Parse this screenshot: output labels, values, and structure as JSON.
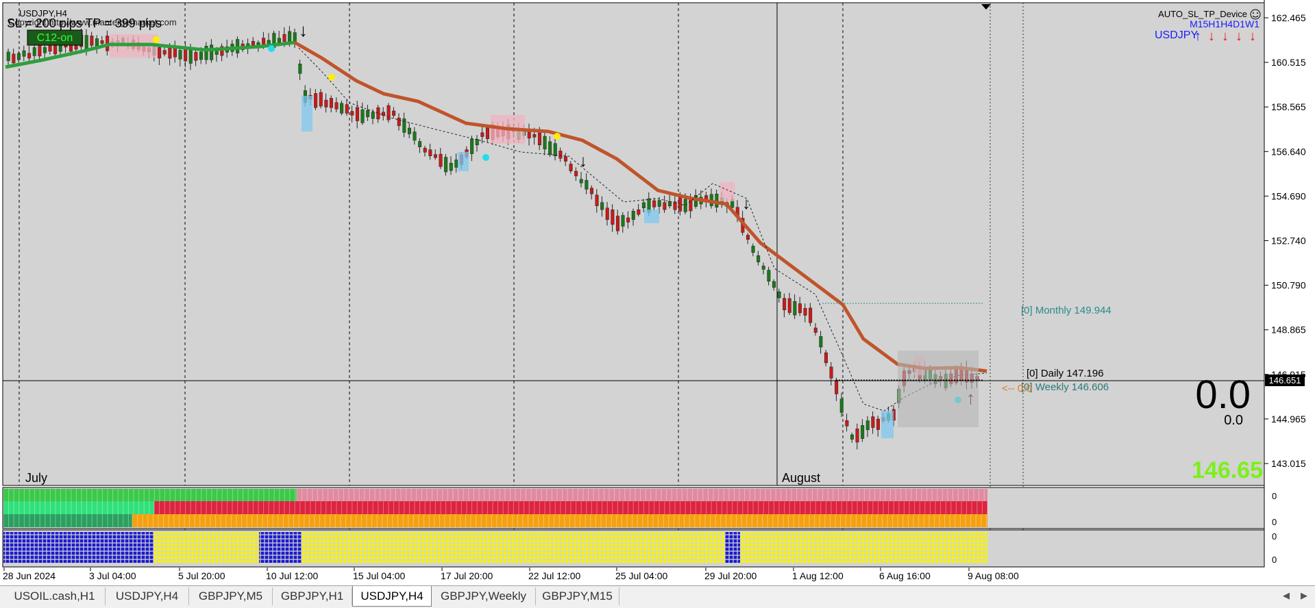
{
  "chart": {
    "symbol_title": "USDJPY,H4",
    "header_overlay": "SL = 200 pips   TP = 399 pips",
    "copyright": "Copyright http://www.mantergemarket.com",
    "indicator_button": "C12-on",
    "expert_name": "AUTO_SL_TP_Device",
    "expert_face_icon": "smiley-icon",
    "mtf_symbol": "USDJPY",
    "mtf_timeframes": "M15H1H4D1W1",
    "mtf_arrows": [
      "up",
      "down",
      "down",
      "down",
      "down"
    ],
    "month_labels": [
      "July",
      "August"
    ],
    "level_monthly": "[0] Monthly 149.944",
    "level_daily": "[0] Daily 147.196",
    "level_weekly": "[0] Weekly 146.606",
    "level_arrow_text": "<-- 0.0",
    "big_value": "0.0",
    "small_value": "0.0",
    "price_display": "146.65",
    "current_price_label": "146.651",
    "colors": {
      "ma": "#c0542b",
      "ma_early": "#2e9e3e",
      "bull": "#1a7a1a",
      "bear": "#cc1a1a",
      "price_green": "#7bf01a"
    }
  },
  "price_axis": [
    "162.465",
    "160.515",
    "158.565",
    "156.640",
    "154.690",
    "152.740",
    "150.790",
    "148.865",
    "146.915",
    "144.965",
    "143.015"
  ],
  "time_axis": [
    "28 Jun 2024",
    "3 Jul 04:00",
    "5 Jul 20:00",
    "10 Jul 12:00",
    "15 Jul 04:00",
    "17 Jul 20:00",
    "22 Jul 12:00",
    "25 Jul 04:00",
    "29 Jul 20:00",
    "1 Aug 12:00",
    "6 Aug 16:00",
    "9 Aug 08:00"
  ],
  "indicator1_scale": [
    "0",
    "0"
  ],
  "indicator2_scale": [
    "0",
    "0"
  ],
  "tabs": [
    "USOIL.cash,H1",
    "USDJPY,H4",
    "GBPJPY,M5",
    "GBPJPY,H1",
    "USDJPY,H4",
    "GBPJPY,Weekly",
    "GBPJPY,M15"
  ],
  "active_tab": 4,
  "chart_data": {
    "type": "line",
    "series": [
      {
        "name": "",
        "x": [
          "28 Jun 2024",
          "3 Jul 04:00",
          "5 Jul 20:00",
          "10 Jul 12:00",
          "15 Jul 04:00",
          "17 Jul 20:00",
          "22 Jul 12:00",
          "25 Jul 04:00",
          "29 Jul 20:00",
          "1 Aug 12:00",
          "6 Aug 16:00",
          "9 Aug 08:00"
        ],
        "values": [
          160.9,
          161.7,
          161.2,
          161.5,
          158.0,
          157.0,
          156.7,
          154.6,
          154.2,
          148.5,
          146.8,
          146.65
        ]
      }
    ],
    "ylim": [
      142.5,
      163.0
    ]
  }
}
